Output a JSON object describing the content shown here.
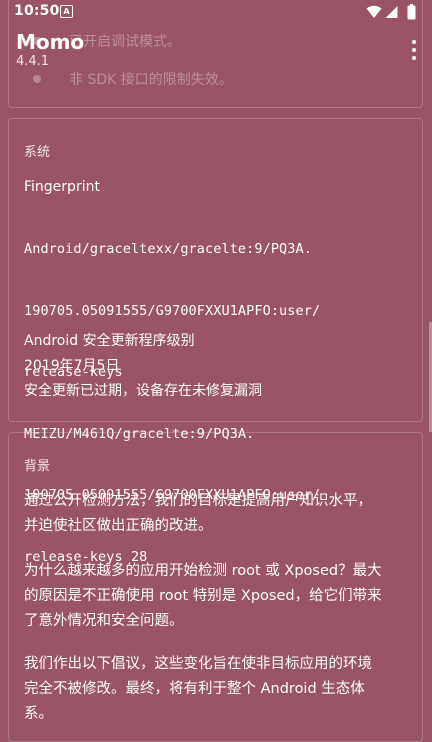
{
  "status_bar": {
    "time": "10:50",
    "notification_icon": "a-notification-icon",
    "icons": [
      "wifi-icon",
      "signal-icon",
      "battery-icon"
    ]
  },
  "app_bar": {
    "title": "Momo",
    "version": "4.4.1",
    "menu_icon": "more-vert-icon"
  },
  "top_card": {
    "line1": "已开启调试模式。",
    "line2": "非 SDK 接口的限制失效。"
  },
  "system_card": {
    "header": "系统",
    "fingerprint_label": "Fingerprint",
    "fingerprint_lines": [
      "Android/graceltexx/gracelte:9/PQ3A.",
      "190705.05091555/G9700FXXU1APFO:user/",
      "release-keys",
      "MEIZU/M461Q/gracelte:9/PQ3A.",
      "190705.05091555/G9700FXXU1APFO:user/",
      "release-keys 28"
    ],
    "patch_label": "Android 安全更新程序级别",
    "patch_date": "2019年7月5日",
    "patch_warning": "安全更新已过期，设备存在未修复漏洞"
  },
  "background_card": {
    "header": "背景",
    "paragraphs": [
      [
        "通过公开检测方法，我们的目标是提高用户知识水平，",
        "并迫使社区做出正确的改进。"
      ],
      [
        "为什么越来越多的应用开始检测 root 或 Xposed？最大",
        "的原因是不正确使用 root 特别是 Xposed，给它们带来",
        "了意外情况和安全问题。"
      ],
      [
        "我们作出以下倡议，这些变化旨在使非目标应用的环境",
        "完全不被修改。最终，将有利于整个 Android 生态体",
        "系。"
      ]
    ]
  },
  "colors": {
    "background": "#9a5466",
    "text": "#ffffff"
  }
}
